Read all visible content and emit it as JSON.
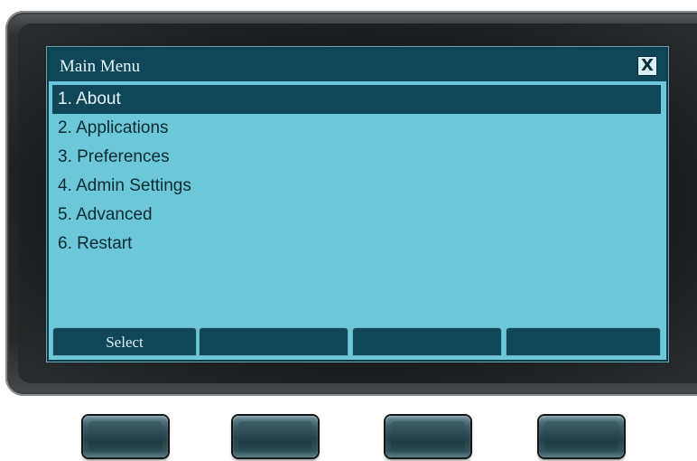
{
  "menu": {
    "title": "Main Menu",
    "close_label": "X",
    "items": [
      {
        "label": "1. About",
        "selected": true
      },
      {
        "label": "2. Applications",
        "selected": false
      },
      {
        "label": "3. Preferences",
        "selected": false
      },
      {
        "label": "4. Admin Settings",
        "selected": false
      },
      {
        "label": "5. Advanced",
        "selected": false
      },
      {
        "label": "6. Restart",
        "selected": false
      }
    ]
  },
  "softkeys": [
    {
      "label": "Select"
    },
    {
      "label": ""
    },
    {
      "label": ""
    },
    {
      "label": ""
    }
  ],
  "colors": {
    "screen_background": "#6cc7d9",
    "title_bar": "#0f4658",
    "selection": "#0f4658",
    "menu_text": "#0d2a33",
    "bezel": "#1f2224"
  }
}
